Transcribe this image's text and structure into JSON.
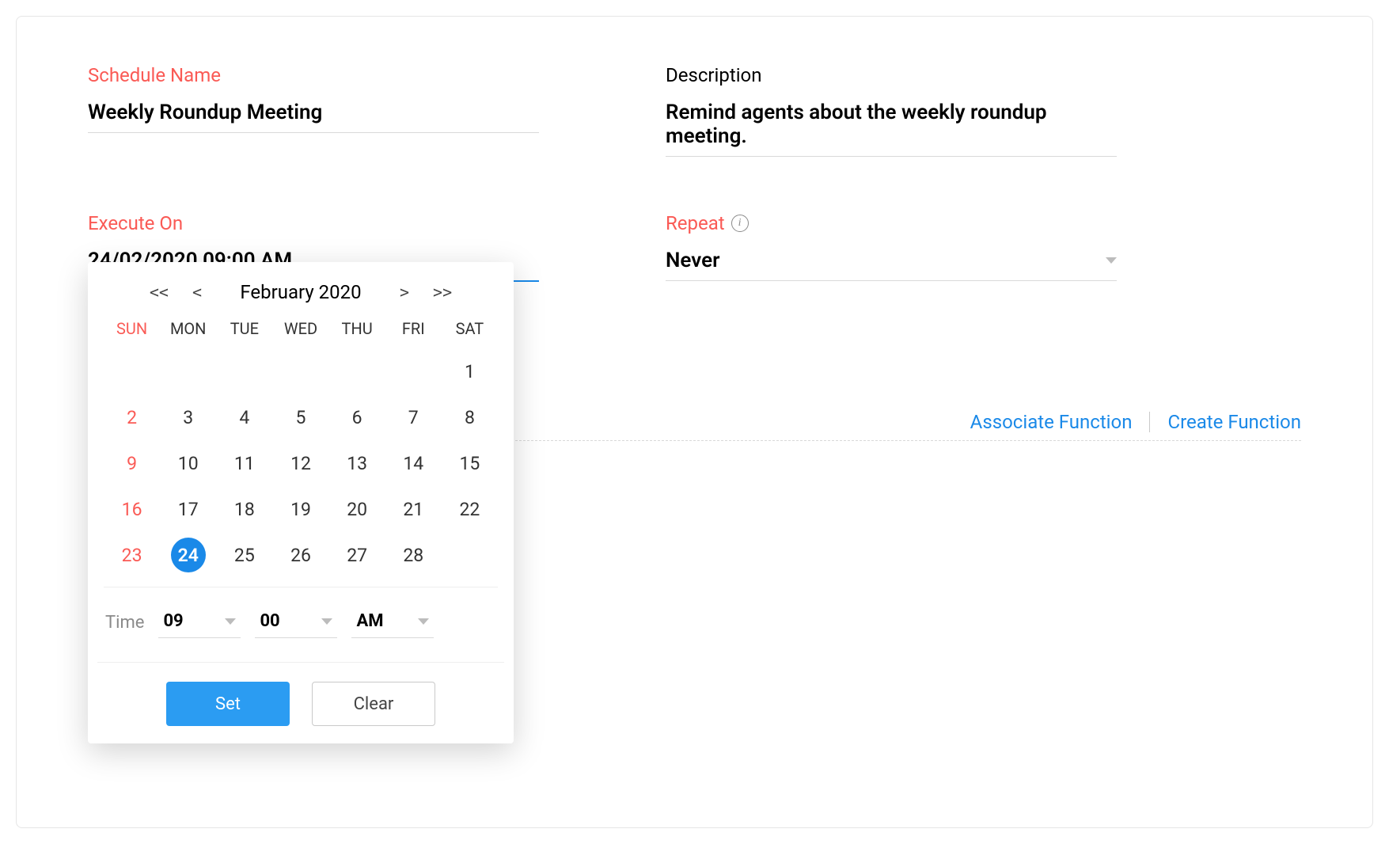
{
  "schedule_name": {
    "label": "Schedule Name",
    "value": "Weekly Roundup Meeting"
  },
  "description": {
    "label": "Description",
    "value": "Remind agents about the weekly roundup meeting."
  },
  "execute_on": {
    "label": "Execute On",
    "value": "24/02/2020 09:00 AM"
  },
  "repeat": {
    "label": "Repeat",
    "value": "Never"
  },
  "links": {
    "associate": "Associate Function",
    "create": "Create Function"
  },
  "calendar": {
    "nav": {
      "prev_year": "<<",
      "prev_month": "<",
      "title": "February 2020",
      "next_month": ">",
      "next_year": ">>"
    },
    "dow": [
      "SUN",
      "MON",
      "TUE",
      "WED",
      "THU",
      "FRI",
      "SAT"
    ],
    "cells": [
      "",
      "",
      "",
      "",
      "",
      "",
      "1",
      "2",
      "3",
      "4",
      "5",
      "6",
      "7",
      "8",
      "9",
      "10",
      "11",
      "12",
      "13",
      "14",
      "15",
      "16",
      "17",
      "18",
      "19",
      "20",
      "21",
      "22",
      "23",
      "24",
      "25",
      "26",
      "27",
      "28",
      ""
    ],
    "selected": "24",
    "time": {
      "label": "Time",
      "hour": "09",
      "minute": "00",
      "period": "AM"
    },
    "buttons": {
      "set": "Set",
      "clear": "Clear"
    }
  }
}
